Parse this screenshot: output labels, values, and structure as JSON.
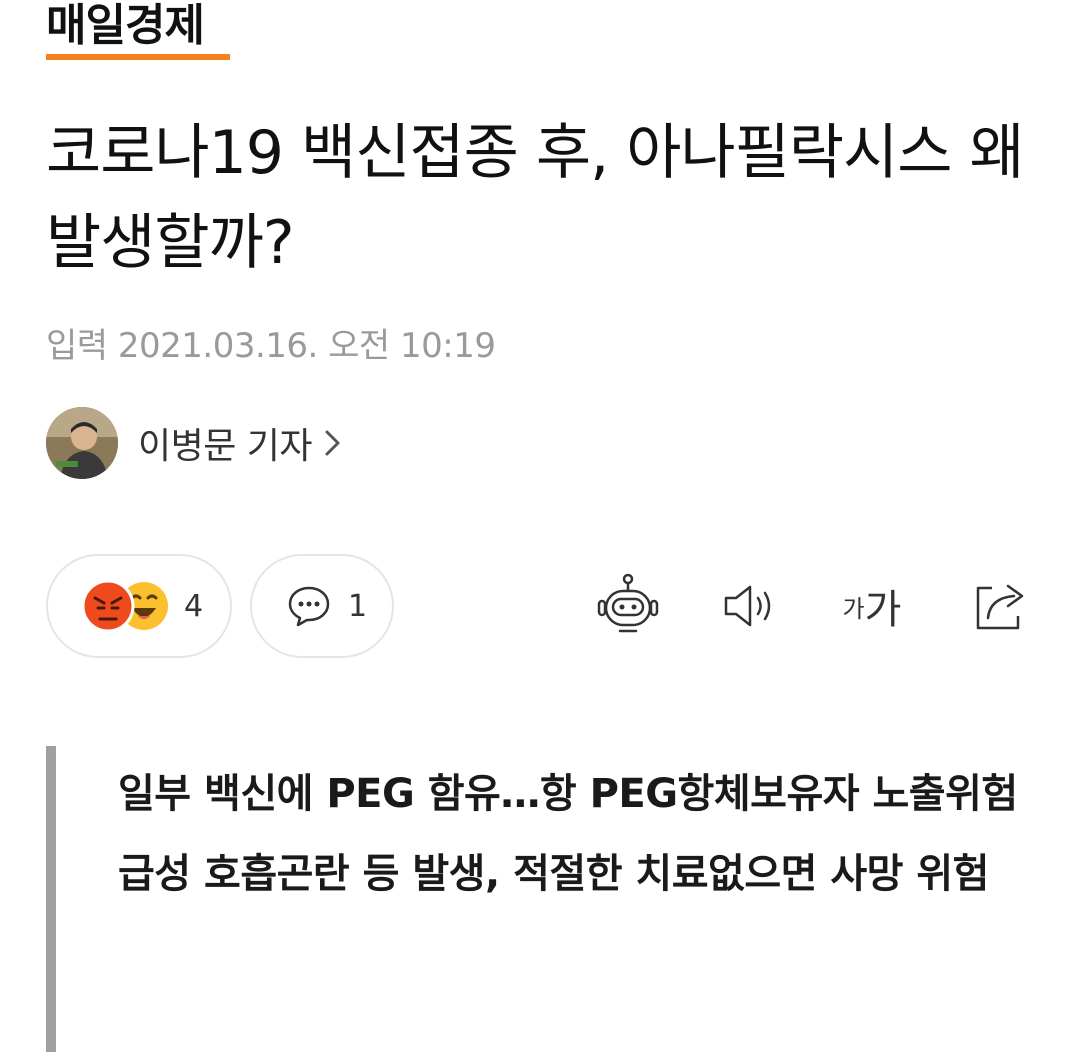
{
  "brand": {
    "name": "매일경제",
    "accent_color": "#f58220"
  },
  "article": {
    "title": "코로나19 백신접종 후, 아나필락시스 왜 발생할까?",
    "published": "입력 2021.03.16. 오전 10:19",
    "author": {
      "name": "이병문 기자",
      "avatar_icon": "author-photo"
    },
    "summary": [
      "일부 백신에 PEG 함유…항 PEG항체보유자 노출위험",
      "급성 호흡곤란 등 발생, 적절한 치료없으면 사망 위험"
    ]
  },
  "actions": {
    "reactions": {
      "count": "4",
      "emojis": [
        "angry-face-icon",
        "laughing-face-icon"
      ]
    },
    "comments": {
      "count": "1",
      "icon": "speech-bubble-icon"
    },
    "tools": [
      {
        "name": "summary-bot",
        "icon": "robot-icon"
      },
      {
        "name": "text-to-speech",
        "icon": "speaker-icon"
      },
      {
        "name": "font-size",
        "label_small": "가",
        "label_large": "가"
      },
      {
        "name": "share",
        "icon": "share-icon"
      }
    ]
  }
}
